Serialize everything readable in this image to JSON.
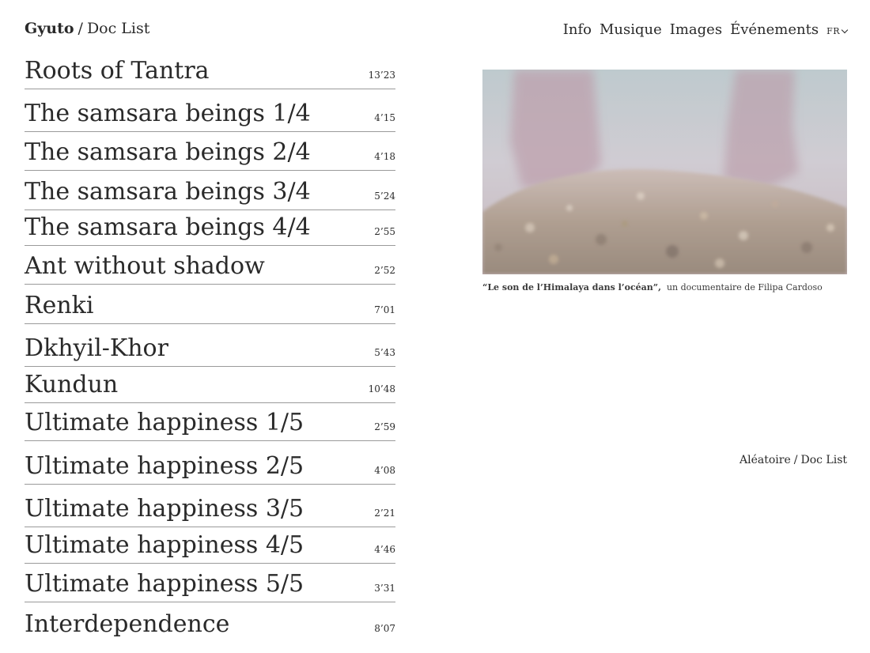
{
  "header": {
    "site_name": "Gyuto",
    "separator": "/",
    "section": "Doc List"
  },
  "nav": {
    "items": [
      "Info",
      "Musique",
      "Images",
      "Événements"
    ],
    "language": "FR"
  },
  "documentaries": [
    {
      "title": "Roots of Tantra",
      "duration": "13’23"
    },
    {
      "title": "The samsara beings 1/4",
      "duration": "4’15"
    },
    {
      "title": "The samsara beings 2/4",
      "duration": "4’18"
    },
    {
      "title": "The samsara beings 3/4",
      "duration": "5’24"
    },
    {
      "title": "The samsara beings 4/4",
      "duration": "2’55"
    },
    {
      "title": "Ant without shadow",
      "duration": "2’52"
    },
    {
      "title": "Renki",
      "duration": "7’01"
    },
    {
      "title": "Dkhyil-Khor",
      "duration": "5’43"
    },
    {
      "title": "Kundun",
      "duration": "10’48"
    },
    {
      "title": "Ultimate happiness 1/5",
      "duration": "2’59"
    },
    {
      "title": "Ultimate happiness 2/5",
      "duration": "4’08"
    },
    {
      "title": "Ultimate happiness 3/5",
      "duration": "2’21"
    },
    {
      "title": "Ultimate happiness 4/5",
      "duration": "4’46"
    },
    {
      "title": "Ultimate happiness 5/5",
      "duration": "3’31"
    },
    {
      "title": "Interdependence",
      "duration": "8’07"
    }
  ],
  "featured": {
    "caption_quote": "“Le son de l’Himalaya dans l’océan”,",
    "caption_text": "un documentaire de Filipa Cardoso"
  },
  "footer_links": {
    "random": "Aléatoire",
    "separator": "/",
    "doc_list": "Doc List"
  }
}
